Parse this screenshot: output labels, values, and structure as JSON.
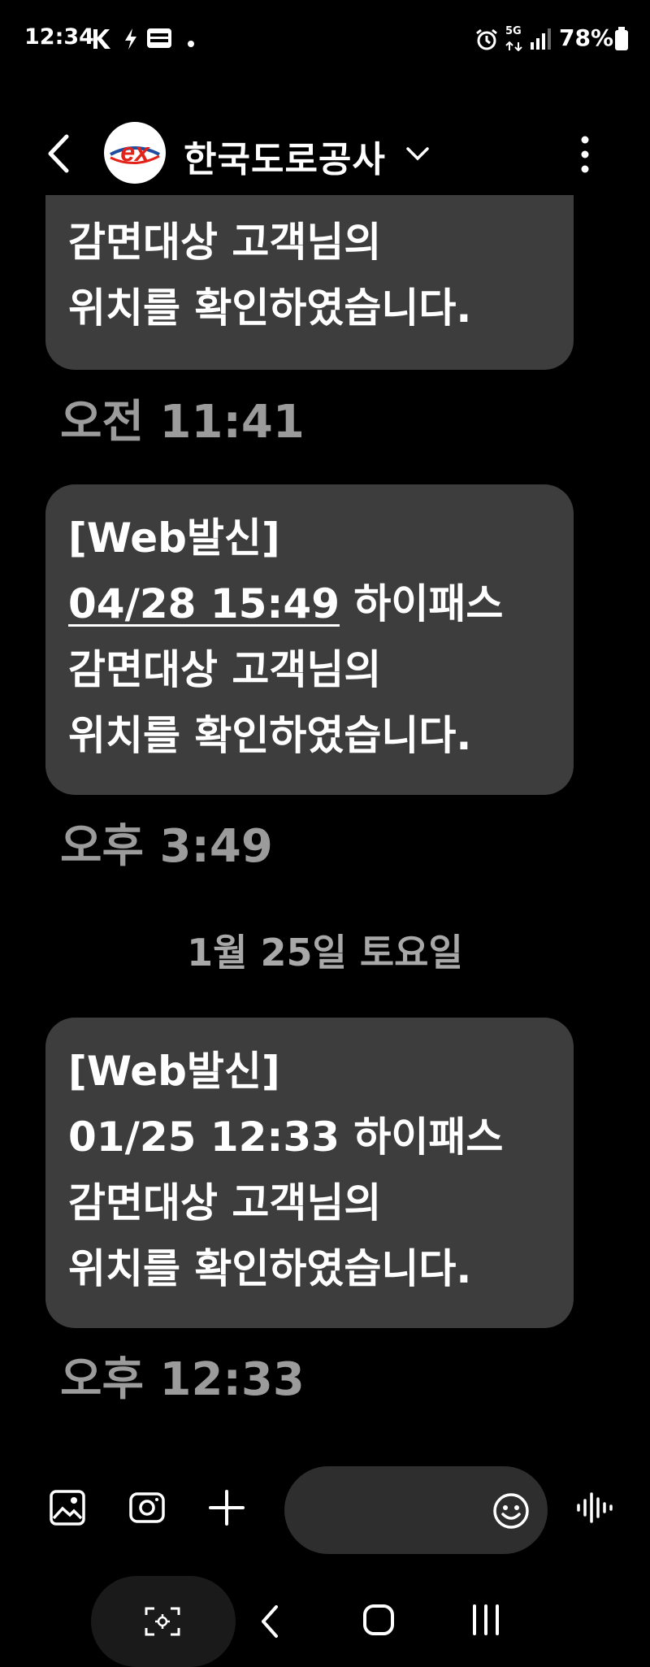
{
  "status_bar": {
    "time": "12:34",
    "network": "5G",
    "battery": "78%"
  },
  "header": {
    "contact_name": "한국도로공사",
    "logo_text": "ex"
  },
  "messages": [
    {
      "lines": [
        "감면대상 고객님의",
        "위치를 확인하였습니다."
      ],
      "time": "오전 11:41"
    },
    {
      "lines": [
        "[Web발신]",
        "하이패스",
        "감면대상 고객님의",
        "위치를 확인하였습니다."
      ],
      "link": "04/28 15:49",
      "time": "오후 3:49"
    },
    {
      "lines": [
        "[Web발신]",
        "01/25 12:33 하이패스",
        "감면대상 고객님의",
        "위치를 확인하였습니다."
      ],
      "time": "오후 12:33"
    }
  ],
  "date_separator": "1월 25일 토요일",
  "colors": {
    "background": "#000000",
    "bubble": "#3d3d3d",
    "timestamp": "#9b9b9b",
    "logo_red": "#e2231a",
    "logo_blue": "#1f4ea1"
  },
  "icons": {
    "gallery": "gallery-icon",
    "camera": "camera-icon",
    "add": "plus-icon",
    "emoji": "emoji-icon",
    "voice": "voice-icon"
  }
}
